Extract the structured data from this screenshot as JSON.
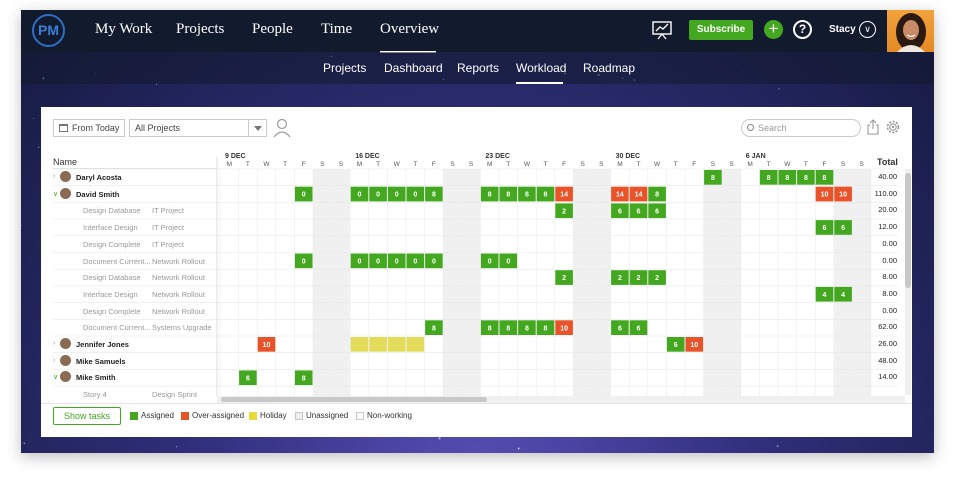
{
  "topnav": {
    "logo": "PM",
    "items": [
      "My Work",
      "Projects",
      "People",
      "Time",
      "Overview"
    ],
    "subscribe": "Subscribe",
    "help": "?",
    "plus": "+",
    "user": "Stacy"
  },
  "subnav": [
    "Projects",
    "Dashboard",
    "Reports",
    "Workload",
    "Roadmap"
  ],
  "toolbar": {
    "from_today": "From Today",
    "project_select": "All Projects",
    "search_placeholder": "Search"
  },
  "grid": {
    "name_header": "Name",
    "total_header": "Total",
    "week_labels": [
      "9 DEC",
      "16 DEC",
      "23 DEC",
      "30 DEC",
      "6 JAN"
    ],
    "day_letters": [
      "M",
      "T",
      "W",
      "T",
      "F",
      "S",
      "S",
      "M",
      "T",
      "W",
      "T",
      "F",
      "S",
      "S",
      "M",
      "T",
      "W",
      "T",
      "F",
      "S",
      "S",
      "M",
      "T",
      "W",
      "T",
      "F",
      "S",
      "S",
      "M",
      "T",
      "W",
      "T",
      "F",
      "S",
      "S"
    ],
    "rows": [
      {
        "type": "resource",
        "name": "Daryl Acosta",
        "expanded": false,
        "total": "40.00",
        "cells": [
          {
            "d": 31,
            "v": "8",
            "c": "green"
          },
          {
            "d": 32,
            "v": "8",
            "c": "green"
          },
          {
            "d": 29,
            "v": "8",
            "c": "green"
          },
          {
            "d": 30,
            "v": "8",
            "c": "green"
          },
          {
            "d": 26,
            "v": "8",
            "c": "green"
          }
        ]
      },
      {
        "type": "resource",
        "name": "David Smith",
        "expanded": true,
        "total": "110.00",
        "cells": [
          {
            "d": 4,
            "v": "0",
            "c": "green"
          },
          {
            "d": 7,
            "v": "0",
            "c": "green"
          },
          {
            "d": 8,
            "v": "0",
            "c": "green"
          },
          {
            "d": 9,
            "v": "0",
            "c": "green"
          },
          {
            "d": 10,
            "v": "0",
            "c": "green"
          },
          {
            "d": 11,
            "v": "8",
            "c": "green"
          },
          {
            "d": 14,
            "v": "8",
            "c": "green"
          },
          {
            "d": 15,
            "v": "8",
            "c": "green"
          },
          {
            "d": 16,
            "v": "8",
            "c": "green"
          },
          {
            "d": 17,
            "v": "8",
            "c": "green"
          },
          {
            "d": 18,
            "v": "14",
            "c": "red"
          },
          {
            "d": 21,
            "v": "14",
            "c": "red"
          },
          {
            "d": 22,
            "v": "14",
            "c": "red"
          },
          {
            "d": 23,
            "v": "8",
            "c": "green"
          },
          {
            "d": 32,
            "v": "10",
            "c": "red"
          },
          {
            "d": 33,
            "v": "10",
            "c": "red"
          }
        ]
      },
      {
        "type": "task",
        "name": "Design Database",
        "project": "IT Project",
        "total": "20.00",
        "cells": [
          {
            "d": 18,
            "v": "2",
            "c": "green"
          },
          {
            "d": 21,
            "v": "6",
            "c": "green"
          },
          {
            "d": 22,
            "v": "6",
            "c": "green"
          },
          {
            "d": 23,
            "v": "6",
            "c": "green"
          }
        ]
      },
      {
        "type": "task",
        "name": "Interface Design",
        "project": "IT Project",
        "total": "12.00",
        "cells": [
          {
            "d": 32,
            "v": "6",
            "c": "green"
          },
          {
            "d": 33,
            "v": "6",
            "c": "green"
          }
        ]
      },
      {
        "type": "task",
        "name": "Design Complete",
        "project": "IT Project",
        "total": "0.00",
        "cells": []
      },
      {
        "type": "task",
        "name": "Document Current...",
        "project": "Network Rollout",
        "total": "0.00",
        "cells": [
          {
            "d": 4,
            "v": "0",
            "c": "green"
          },
          {
            "d": 7,
            "v": "0",
            "c": "green"
          },
          {
            "d": 8,
            "v": "0",
            "c": "green"
          },
          {
            "d": 9,
            "v": "0",
            "c": "green"
          },
          {
            "d": 10,
            "v": "0",
            "c": "green"
          },
          {
            "d": 11,
            "v": "0",
            "c": "green"
          },
          {
            "d": 14,
            "v": "0",
            "c": "green"
          },
          {
            "d": 15,
            "v": "0",
            "c": "green"
          }
        ]
      },
      {
        "type": "task",
        "name": "Design Database",
        "project": "Network Rollout",
        "total": "8.00",
        "cells": [
          {
            "d": 18,
            "v": "2",
            "c": "green"
          },
          {
            "d": 21,
            "v": "2",
            "c": "green"
          },
          {
            "d": 22,
            "v": "2",
            "c": "green"
          },
          {
            "d": 23,
            "v": "2",
            "c": "green"
          }
        ]
      },
      {
        "type": "task",
        "name": "Interface Design",
        "project": "Network Rollout",
        "total": "8.00",
        "cells": [
          {
            "d": 32,
            "v": "4",
            "c": "green"
          },
          {
            "d": 33,
            "v": "4",
            "c": "green"
          }
        ]
      },
      {
        "type": "task",
        "name": "Design Complete",
        "project": "Network Rollout",
        "total": "0.00",
        "cells": []
      },
      {
        "type": "task",
        "name": "Document Current...",
        "project": "Systems Upgrade",
        "total": "62.00",
        "cells": [
          {
            "d": 11,
            "v": "8",
            "c": "green"
          },
          {
            "d": 14,
            "v": "8",
            "c": "green"
          },
          {
            "d": 15,
            "v": "8",
            "c": "green"
          },
          {
            "d": 16,
            "v": "8",
            "c": "green"
          },
          {
            "d": 17,
            "v": "8",
            "c": "green"
          },
          {
            "d": 18,
            "v": "10",
            "c": "red"
          },
          {
            "d": 21,
            "v": "6",
            "c": "green"
          },
          {
            "d": 22,
            "v": "6",
            "c": "green"
          }
        ]
      },
      {
        "type": "resource",
        "name": "Jennifer Jones",
        "expanded": false,
        "total": "26.00",
        "cells": [
          {
            "d": 2,
            "v": "10",
            "c": "red"
          },
          {
            "d": 7,
            "v": "",
            "c": "yellow"
          },
          {
            "d": 8,
            "v": "",
            "c": "yellow"
          },
          {
            "d": 9,
            "v": "",
            "c": "yellow"
          },
          {
            "d": 10,
            "v": "",
            "c": "yellow"
          },
          {
            "d": 24,
            "v": "6",
            "c": "green"
          },
          {
            "d": 25,
            "v": "10",
            "c": "red"
          }
        ]
      },
      {
        "type": "resource",
        "name": "Mike Samuels",
        "expanded": false,
        "total": "48.00",
        "cells": []
      },
      {
        "type": "resource",
        "name": "Mike Smith",
        "expanded": true,
        "total": "14.00",
        "cells": [
          {
            "d": 1,
            "v": "6",
            "c": "green"
          },
          {
            "d": 4,
            "v": "8",
            "c": "green"
          }
        ]
      },
      {
        "type": "task",
        "name": "Story 4",
        "project": "Design Sprint",
        "total": "",
        "cells": []
      }
    ]
  },
  "legend": {
    "show_tasks": "Show tasks",
    "items": [
      {
        "label": "Assigned",
        "color": "#43a820"
      },
      {
        "label": "Over-assigned",
        "color": "#e8532a"
      },
      {
        "label": "Holiday",
        "color": "#e6dd3a"
      },
      {
        "label": "Unassigned",
        "color": "#eeeeee"
      },
      {
        "label": "Non-working",
        "color": "#ffffff"
      }
    ]
  },
  "colors": {
    "green": "#43a820",
    "red": "#e8532a",
    "yellow": "#e3dc5a",
    "weekend": "#f0f0f0",
    "header_bg": "#121a2e"
  }
}
